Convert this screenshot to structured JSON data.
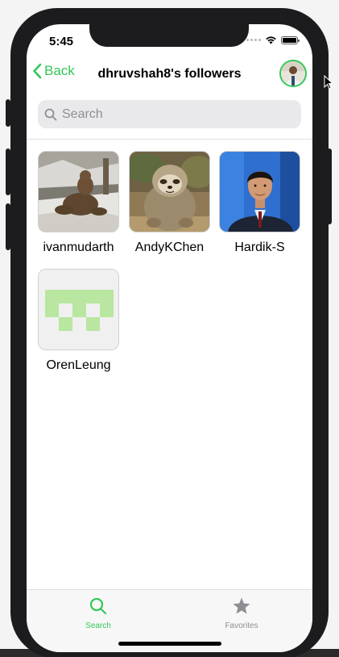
{
  "status": {
    "time": "5:45"
  },
  "nav": {
    "back_label": "Back",
    "title": "dhruvshah8's followers",
    "avatar_icon": "profile-photo"
  },
  "search": {
    "placeholder": "Search",
    "value": ""
  },
  "followers": [
    {
      "username": "ivanmudarth",
      "avatar": "bear-photo"
    },
    {
      "username": "AndyKChen",
      "avatar": "sloth-photo"
    },
    {
      "username": "Hardik-S",
      "avatar": "portrait-photo"
    },
    {
      "username": "OrenLeung",
      "avatar": "identicon-green"
    }
  ],
  "tabbar": {
    "tabs": [
      {
        "label": "Search",
        "icon": "search-icon",
        "active": true
      },
      {
        "label": "Favorites",
        "icon": "star-icon",
        "active": false
      }
    ]
  },
  "colors": {
    "accent": "#34c759",
    "inactive": "#8e8e93",
    "identicon": "#b9e6a0"
  }
}
